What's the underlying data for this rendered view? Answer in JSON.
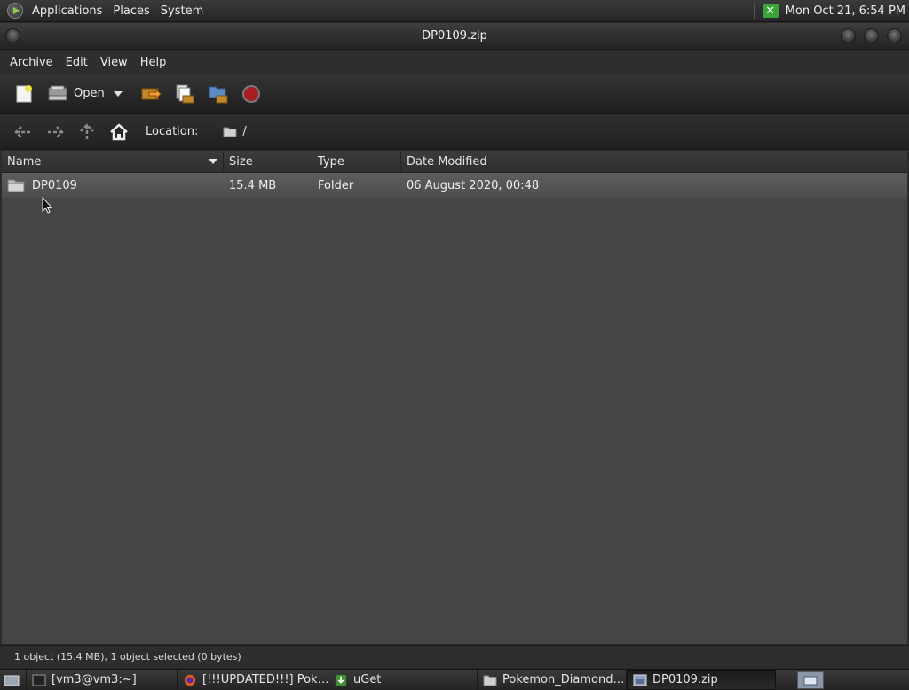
{
  "top_panel": {
    "menu": [
      "Applications",
      "Places",
      "System"
    ],
    "clock": "Mon Oct 21,  6:54 PM",
    "tray_icon": "x-tray-icon"
  },
  "window": {
    "title": "DP0109.zip"
  },
  "menubar": [
    "Archive",
    "Edit",
    "View",
    "Help"
  ],
  "toolbar": {
    "open_label": "Open",
    "icons": [
      "new-archive-icon",
      "open-icon",
      "extract-icon",
      "add-files-icon",
      "add-folder-icon",
      "stop-icon"
    ]
  },
  "location": {
    "label": "Location:",
    "path": "/"
  },
  "columns": {
    "name": "Name",
    "size": "Size",
    "type": "Type",
    "date": "Date Modified"
  },
  "rows": [
    {
      "name": "DP0109",
      "size": "15.4 MB",
      "type": "Folder",
      "date": "06 August 2020, 00:48"
    }
  ],
  "status": "1 object (15.4 MB), 1 object selected (0 bytes)",
  "taskbar": [
    {
      "label": "[vm3@vm3:~]",
      "icon": "terminal-icon"
    },
    {
      "label": "[!!!UPDATED!!!] Pok…",
      "icon": "firefox-icon"
    },
    {
      "label": "uGet",
      "icon": "uget-icon"
    },
    {
      "label": "Pokemon_Diamond…",
      "icon": "folder-icon"
    },
    {
      "label": "DP0109.zip",
      "icon": "archive-icon"
    }
  ],
  "colors": {
    "list_bg": "#454545",
    "row_selected": "#5a5a5a",
    "stop_red": "#c0282a",
    "tray_green": "#3aa33a"
  }
}
